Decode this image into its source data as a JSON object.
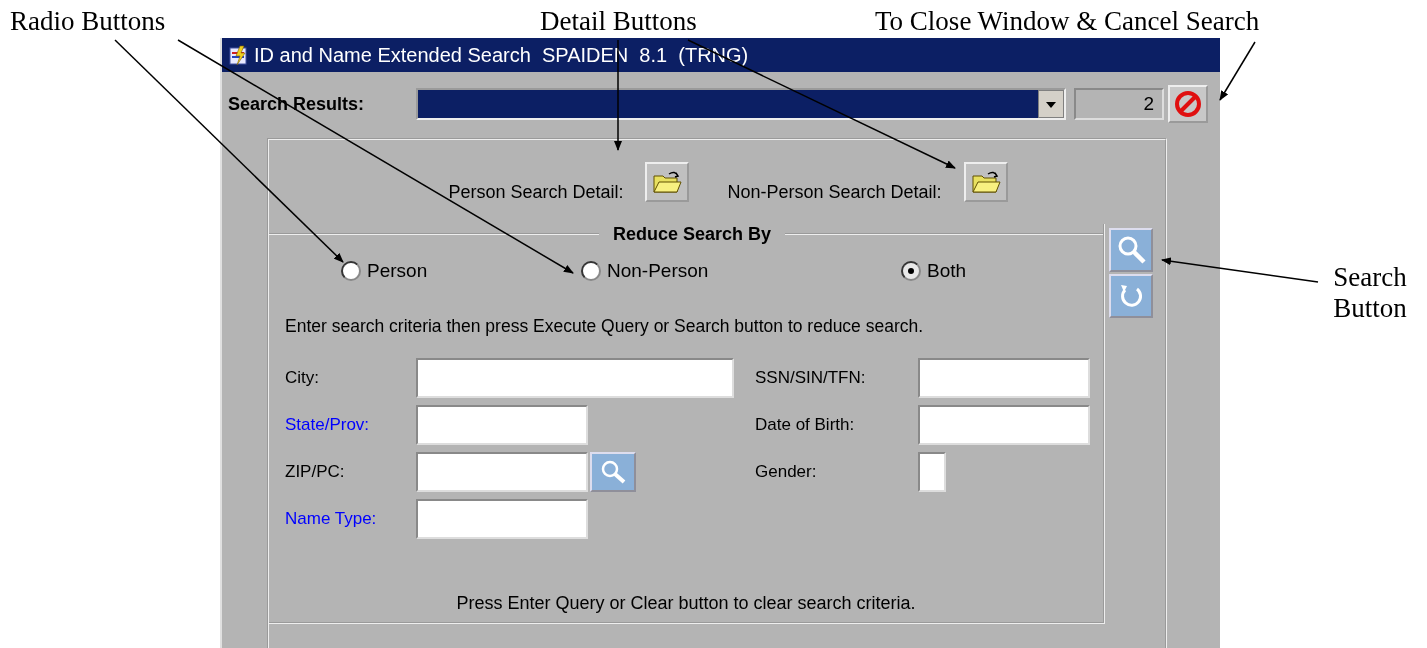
{
  "annotations": [
    {
      "text": "Radio Buttons"
    },
    {
      "text": "Detail Buttons"
    },
    {
      "text": "To Close Window & Cancel Search"
    },
    {
      "text": "Search Button"
    }
  ],
  "window": {
    "title": "ID and Name Extended Search  SPAIDEN  8.1  (TRNG)"
  },
  "search_results": {
    "label": "Search Results:",
    "count": "2"
  },
  "details": [
    {
      "label": "Person Search Detail:"
    },
    {
      "label": "Non-Person Search Detail:"
    }
  ],
  "group": {
    "title": "Reduce Search By"
  },
  "radios": [
    {
      "label": "Person",
      "selected": false
    },
    {
      "label": "Non-Person",
      "selected": false
    },
    {
      "label": "Both",
      "selected": true
    }
  ],
  "instruction": "Enter search criteria then press Execute Query or Search button to reduce search.",
  "fields_left": [
    {
      "label": "City:",
      "color": "#000000",
      "kind": "long",
      "lookup": false
    },
    {
      "label": "State/Prov:",
      "color": "#0000ff",
      "kind": "medium",
      "lookup": false
    },
    {
      "label": "ZIP/PC:",
      "color": "#000000",
      "kind": "medium",
      "lookup": true
    },
    {
      "label": "Name Type:",
      "color": "#0000ff",
      "kind": "medium",
      "lookup": false
    }
  ],
  "fields_right": [
    {
      "label": "SSN/SIN/TFN:",
      "color": "#000000",
      "kind": "medium",
      "lookup": false
    },
    {
      "label": "Date of Birth:",
      "color": "#000000",
      "kind": "medium",
      "lookup": false
    },
    {
      "label": "Gender:",
      "color": "#000000",
      "kind": "char",
      "lookup": false
    }
  ],
  "footer": "Press Enter Query or Clear button to clear search criteria."
}
